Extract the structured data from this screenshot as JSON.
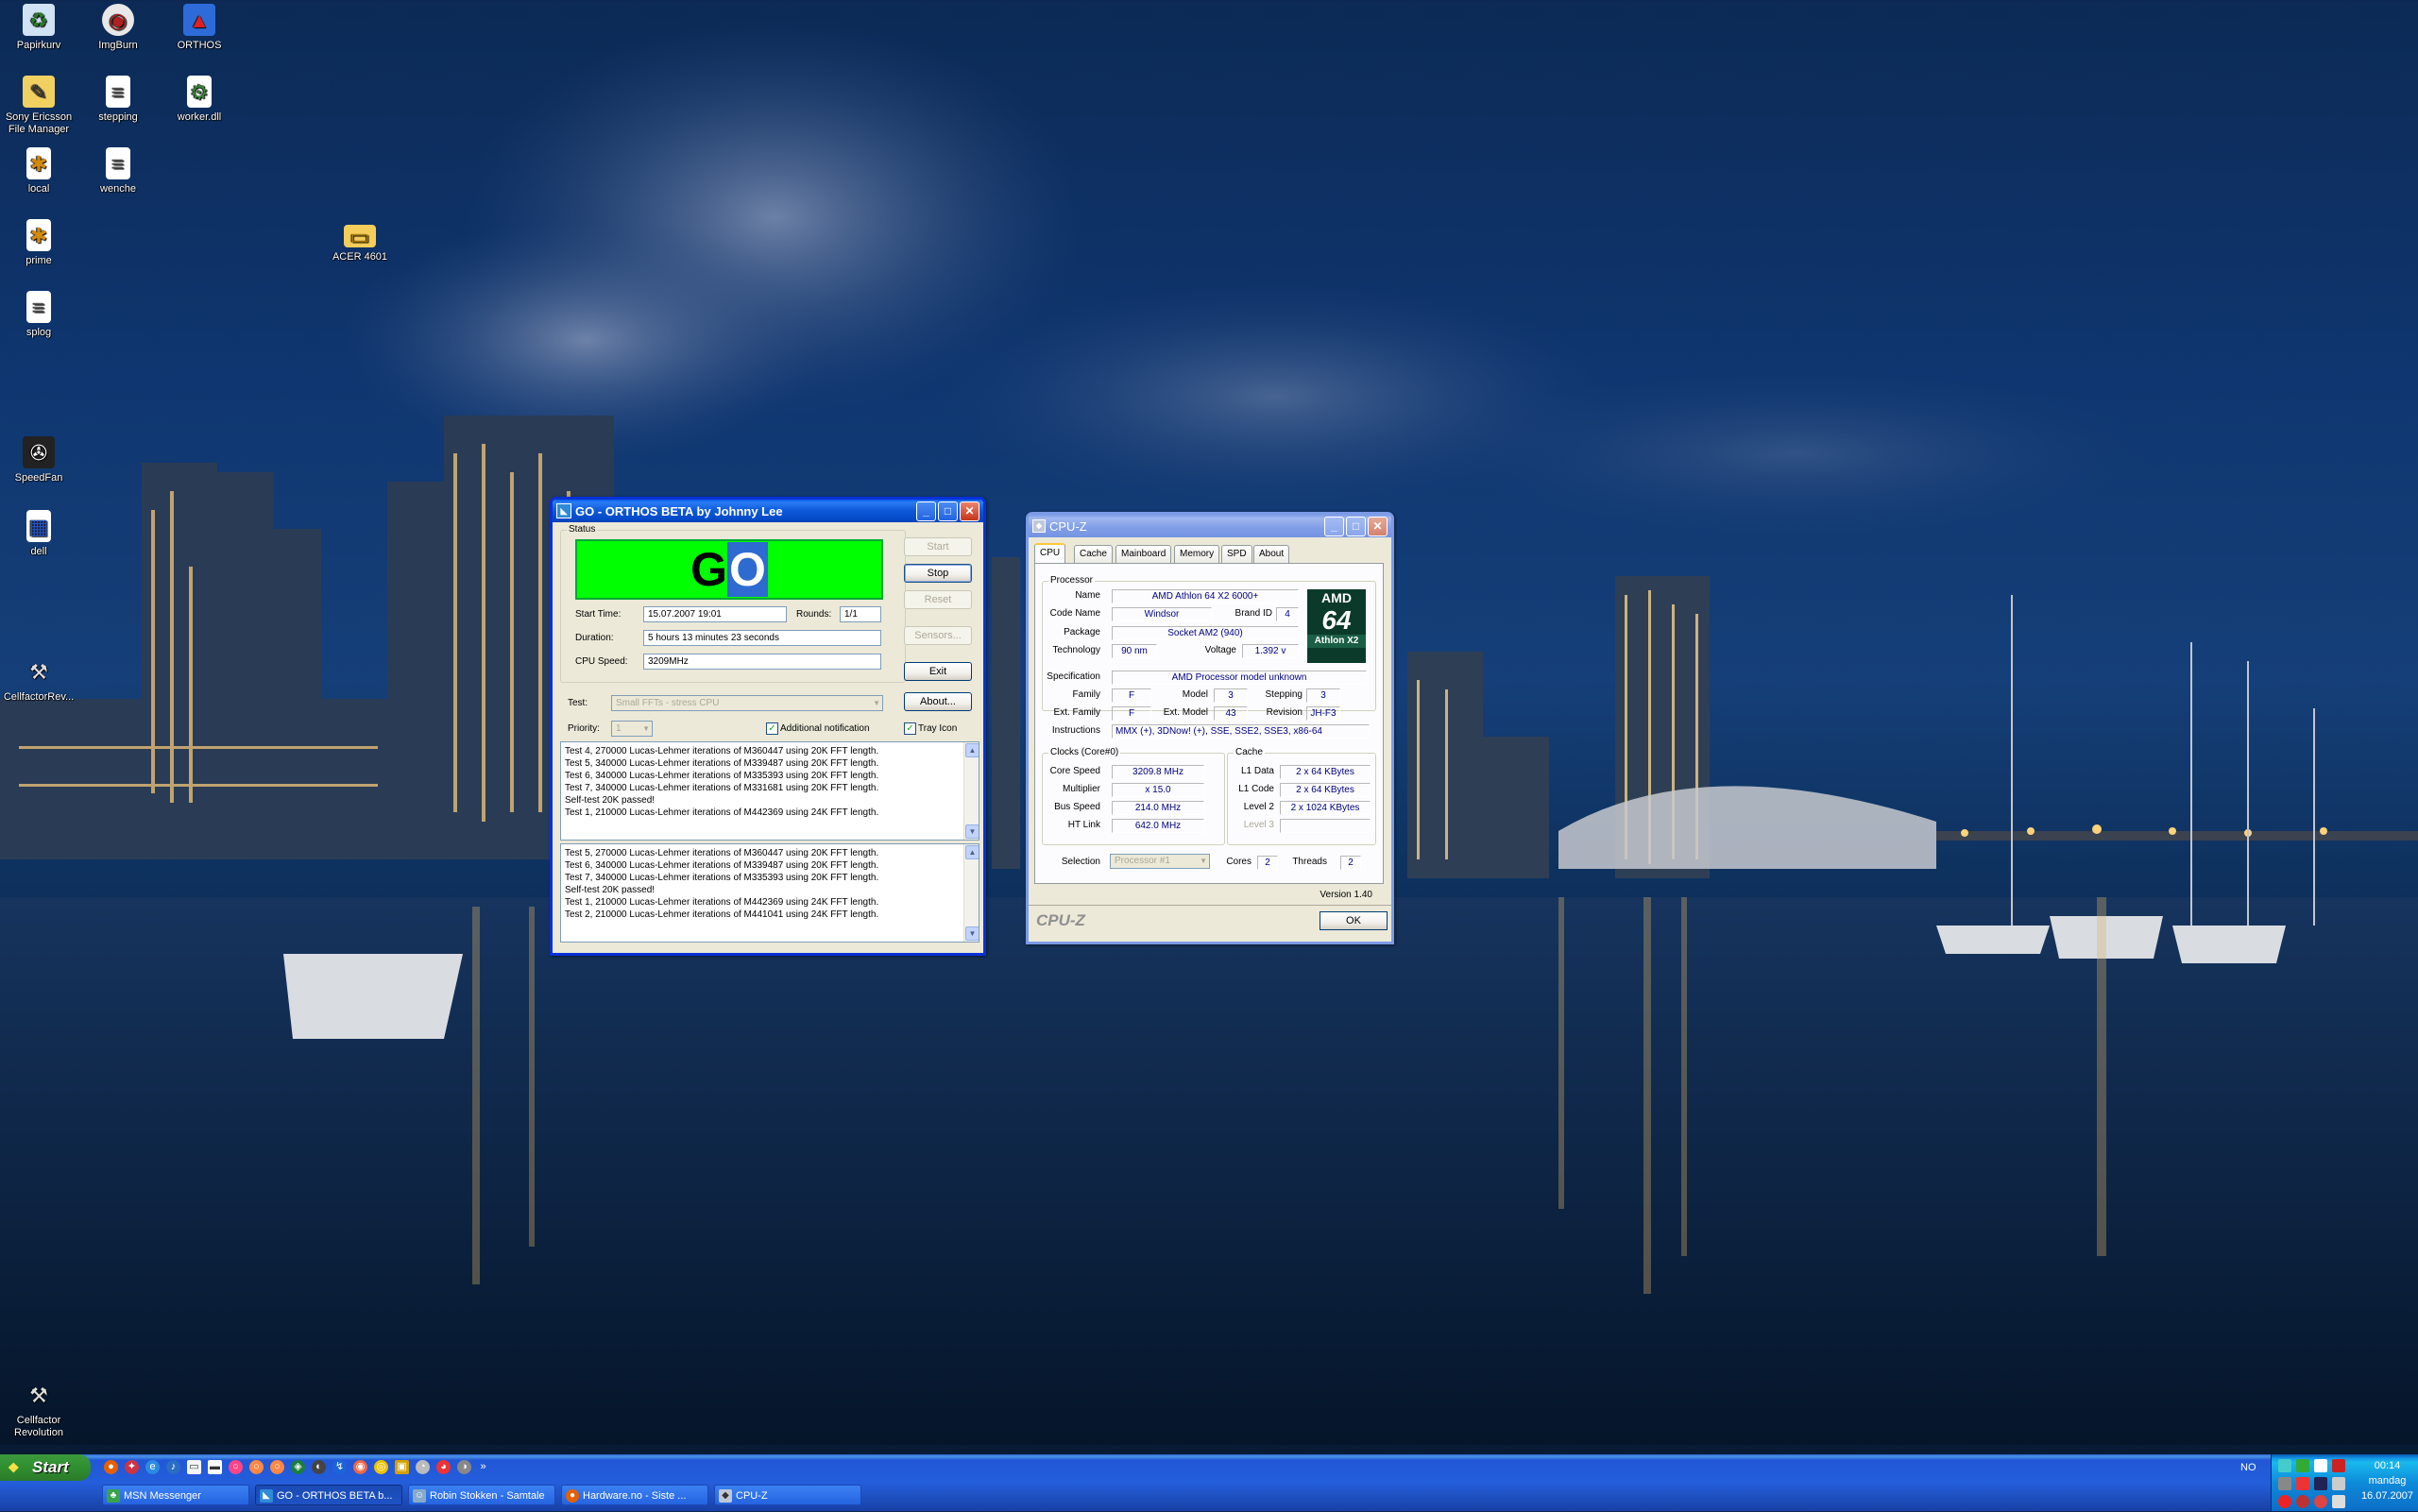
{
  "desktop_icons": [
    {
      "label": "Papirkurv",
      "icon": "recycle-bin-icon"
    },
    {
      "label": "ImgBurn",
      "icon": "disc-icon"
    },
    {
      "label": "ORTHOS",
      "icon": "orthos-icon"
    },
    {
      "label": "Sony Ericsson File Manager",
      "icon": "shortcut-icon"
    },
    {
      "label": "stepping",
      "icon": "text-file-icon"
    },
    {
      "label": "worker.dll",
      "icon": "dll-file-icon"
    },
    {
      "label": "local",
      "icon": "config-file-icon"
    },
    {
      "label": "wenche",
      "icon": "text-file-icon"
    },
    {
      "label": "prime",
      "icon": "config-file-icon"
    },
    {
      "label": "ACER 4601",
      "icon": "folder-icon"
    },
    {
      "label": "splog",
      "icon": "text-file-icon"
    },
    {
      "label": "SpeedFan",
      "icon": "speedfan-icon"
    },
    {
      "label": "dell",
      "icon": "document-icon"
    },
    {
      "label": "CellfactorRev...",
      "icon": "game-icon"
    },
    {
      "label": "Cellfactor Revolution",
      "icon": "game-icon"
    }
  ],
  "orthos": {
    "title": "GO - ORTHOS BETA by Johnny Lee",
    "status_label": "Status",
    "go_text_g": "G",
    "go_text_o": "O",
    "go_color": "#00ff00",
    "start_time_label": "Start Time:",
    "start_time_value": "15.07.2007 19:01",
    "rounds_label": "Rounds:",
    "rounds_value": "1/1",
    "duration_label": "Duration:",
    "duration_value": "5 hours 13 minutes 23 seconds",
    "cpu_speed_label": "CPU Speed:",
    "cpu_speed_value": "3209MHz",
    "test_label": "Test:",
    "test_value": "Small FFTs - stress CPU",
    "priority_label": "Priority:",
    "priority_value": "1",
    "additional_notification": "Additional notification",
    "tray_icon": "Tray Icon",
    "buttons": {
      "start": "Start",
      "stop": "Stop",
      "reset": "Reset",
      "sensors": "Sensors...",
      "exit": "Exit",
      "about": "About..."
    },
    "log1": [
      "Test 4, 270000 Lucas-Lehmer iterations of M360447 using 20K FFT length.",
      "Test 5, 340000 Lucas-Lehmer iterations of M339487 using 20K FFT length.",
      "Test 6, 340000 Lucas-Lehmer iterations of M335393 using 20K FFT length.",
      "Test 7, 340000 Lucas-Lehmer iterations of M331681 using 20K FFT length.",
      "Self-test 20K passed!",
      "Test 1, 210000 Lucas-Lehmer iterations of M442369 using 24K FFT length."
    ],
    "log2": [
      "Test 5, 270000 Lucas-Lehmer iterations of M360447 using 20K FFT length.",
      "Test 6, 340000 Lucas-Lehmer iterations of M339487 using 20K FFT length.",
      "Test 7, 340000 Lucas-Lehmer iterations of M335393 using 20K FFT length.",
      "Self-test 20K passed!",
      "Test 1, 210000 Lucas-Lehmer iterations of M442369 using 24K FFT length.",
      "Test 2, 210000 Lucas-Lehmer iterations of M441041 using 24K FFT length."
    ]
  },
  "cpuz": {
    "title": "CPU-Z",
    "tabs": [
      "CPU",
      "Cache",
      "Mainboard",
      "Memory",
      "SPD",
      "About"
    ],
    "processor_group": "Processor",
    "name_label": "Name",
    "name_value": "AMD Athlon 64 X2 6000+",
    "codename_label": "Code Name",
    "codename_value": "Windsor",
    "brandid_label": "Brand ID",
    "brandid_value": "4",
    "package_label": "Package",
    "package_value": "Socket AM2 (940)",
    "technology_label": "Technology",
    "technology_value": "90 nm",
    "voltage_label": "Voltage",
    "voltage_value": "1.392 v",
    "logo_top": "AMD",
    "logo_mid": "64",
    "logo_bottom": "Athlon X2",
    "spec_label": "Specification",
    "spec_value": "AMD Processor model unknown",
    "family_label": "Family",
    "family_value": "F",
    "model_label": "Model",
    "model_value": "3",
    "stepping_label": "Stepping",
    "stepping_value": "3",
    "extfamily_label": "Ext. Family",
    "extfamily_value": "F",
    "extmodel_label": "Ext. Model",
    "extmodel_value": "43",
    "revision_label": "Revision",
    "revision_value": "JH-F3",
    "instructions_label": "Instructions",
    "instructions_value": "MMX (+), 3DNow! (+), SSE, SSE2, SSE3, x86-64",
    "clocks_group": "Clocks (Core#0)",
    "corespeed_label": "Core Speed",
    "corespeed_value": "3209.8 MHz",
    "multiplier_label": "Multiplier",
    "multiplier_value": "x 15.0",
    "busspeed_label": "Bus Speed",
    "busspeed_value": "214.0 MHz",
    "htlink_label": "HT Link",
    "htlink_value": "642.0 MHz",
    "cache_group": "Cache",
    "l1data_label": "L1 Data",
    "l1data_value": "2 x 64 KBytes",
    "l1code_label": "L1 Code",
    "l1code_value": "2 x 64 KBytes",
    "level2_label": "Level 2",
    "level2_value": "2 x 1024 KBytes",
    "level3_label": "Level 3",
    "level3_value": "",
    "selection_label": "Selection",
    "selection_value": "Processor #1",
    "cores_label": "Cores",
    "cores_value": "2",
    "threads_label": "Threads",
    "threads_value": "2",
    "version": "Version 1.40",
    "brand": "CPU-Z",
    "ok": "OK"
  },
  "taskbar": {
    "start": "Start",
    "items": [
      {
        "label": "MSN Messenger",
        "active": false
      },
      {
        "label": "GO - ORTHOS BETA b...",
        "active": true
      },
      {
        "label": "Robin Stokken - Samtale",
        "active": false
      },
      {
        "label": "Hardware.no - Siste ...",
        "active": false
      },
      {
        "label": "CPU-Z",
        "active": false
      }
    ],
    "lang": "NO",
    "clock_time": "00:14",
    "clock_day": "mandag",
    "clock_date": "16.07.2007"
  }
}
